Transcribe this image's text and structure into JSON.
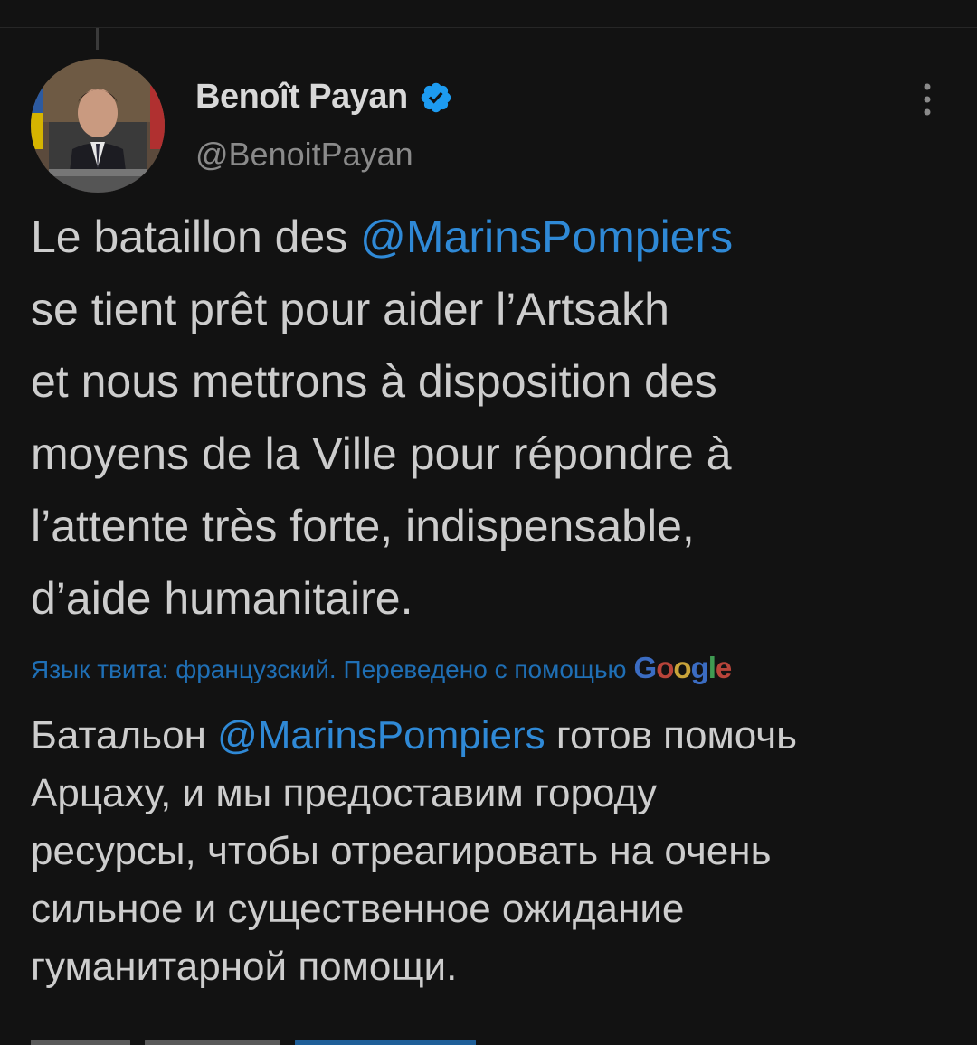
{
  "author": {
    "display_name": "Benoît Payan",
    "handle": "@BenoitPayan",
    "verified": true
  },
  "tweet": {
    "lines": [
      {
        "pre": "Le bataillon des ",
        "mention": "@MarinsPompiers",
        "post": ""
      },
      {
        "pre": "se tient prêt pour aider l’Artsakh",
        "mention": "",
        "post": ""
      },
      {
        "pre": "et nous mettrons à disposition des",
        "mention": "",
        "post": ""
      },
      {
        "pre": "moyens de la Ville pour répondre à",
        "mention": "",
        "post": ""
      },
      {
        "pre": "l’attente très forte, indispensable,",
        "mention": "",
        "post": ""
      },
      {
        "pre": "d’aide humanitaire.",
        "mention": "",
        "post": ""
      }
    ]
  },
  "translation": {
    "note": "Язык твита: французский. Переведено с помощью",
    "provider": "Google",
    "lines": [
      {
        "pre": "Батальон ",
        "mention": "@MarinsPompiers",
        "post": " готов помочь"
      },
      {
        "pre": "Арцаху, и мы предоставим городу",
        "mention": "",
        "post": ""
      },
      {
        "pre": "ресурсы, чтобы отреагировать на очень",
        "mention": "",
        "post": ""
      },
      {
        "pre": "сильное и существенное ожидание",
        "mention": "",
        "post": ""
      },
      {
        "pre": "гуманитарной помощи.",
        "mention": "",
        "post": ""
      }
    ]
  },
  "colors": {
    "background": "#121212",
    "text": "#cdcdcd",
    "mention": "#2f89d6",
    "verified": "#1d9bf0",
    "translate_note": "#1f6fb5"
  },
  "icons": {
    "verified": "verified-badge-icon",
    "more": "more-vertical-icon"
  }
}
